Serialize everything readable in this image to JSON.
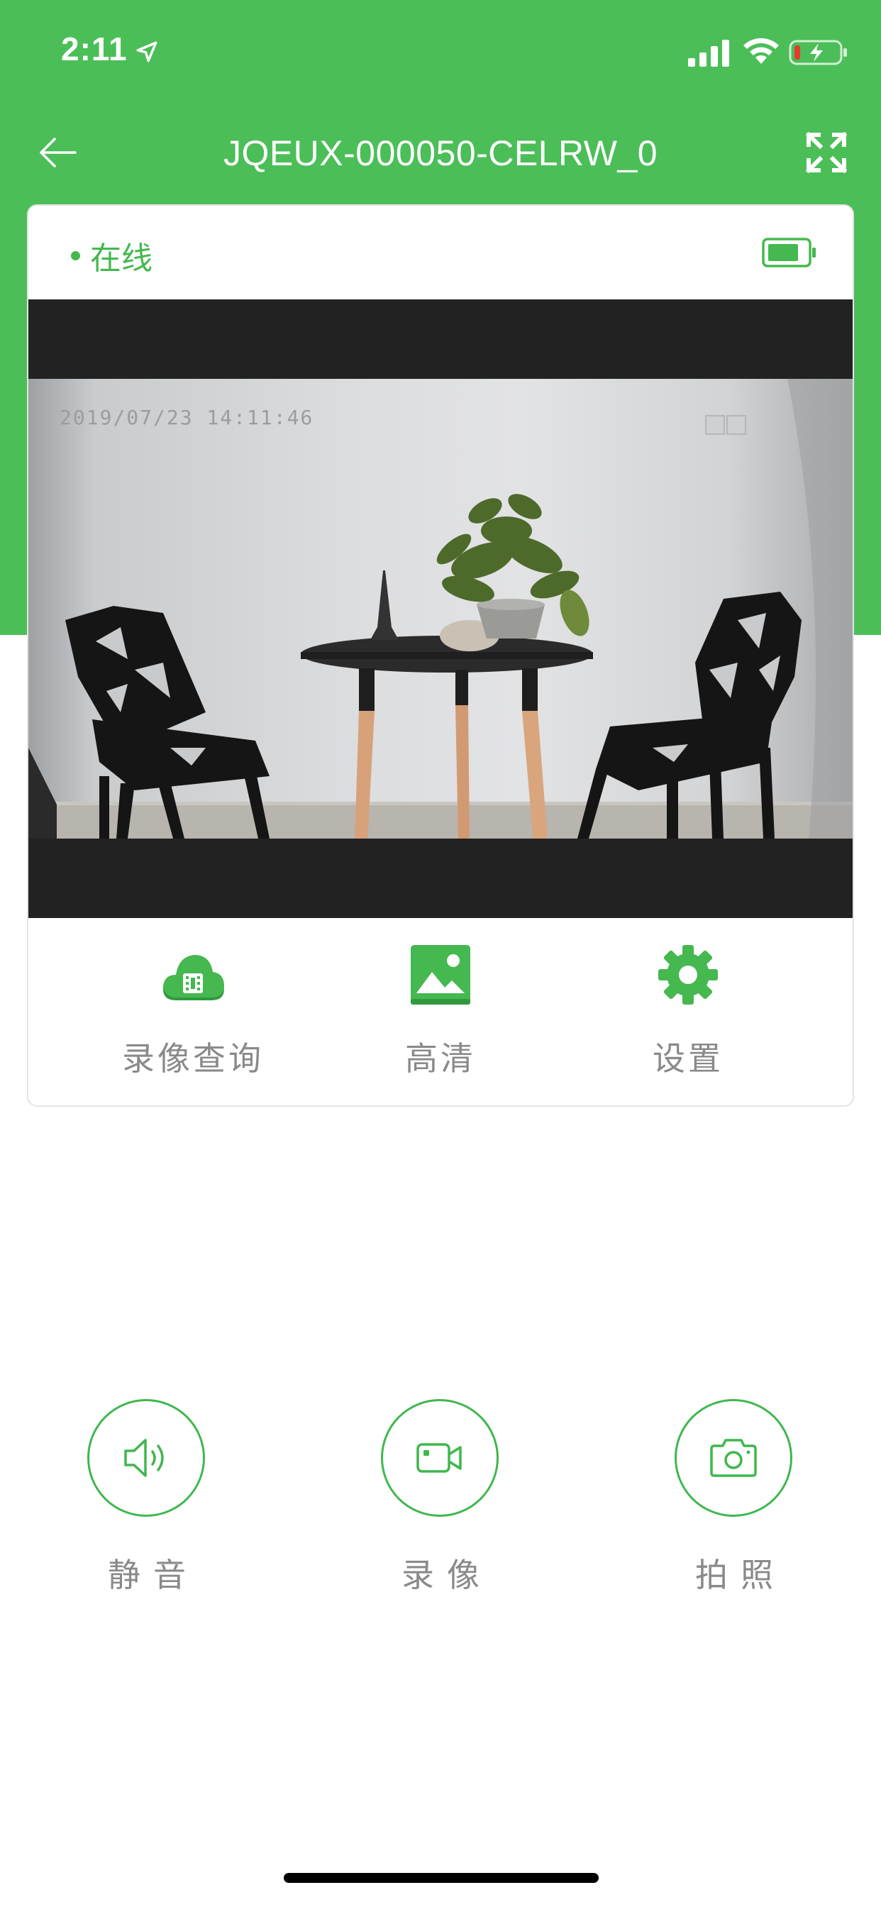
{
  "status_bar": {
    "time": "2:11"
  },
  "nav": {
    "title": "JQEUX-000050-CELRW_0"
  },
  "device": {
    "status_text": "在线"
  },
  "video": {
    "timestamp": "2019/07/23 14:11:46"
  },
  "actions": [
    {
      "label": "录像查询",
      "icon": "cloud-video-icon"
    },
    {
      "label": "高清",
      "icon": "image-icon"
    },
    {
      "label": "设置",
      "icon": "gear-icon"
    }
  ],
  "controls": [
    {
      "label": "静音",
      "icon": "speaker-icon"
    },
    {
      "label": "录像",
      "icon": "video-camera-icon"
    },
    {
      "label": "拍照",
      "icon": "camera-icon"
    }
  ],
  "colors": {
    "brand_green": "#4bbe58",
    "accent_green": "#3fb74e",
    "label_gray": "#8a8a8a"
  }
}
